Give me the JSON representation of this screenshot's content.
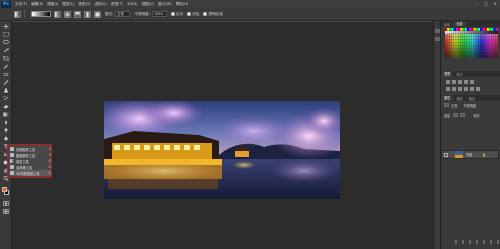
{
  "app": {
    "logo": "Ps"
  },
  "menu": [
    "文件(F)",
    "编辑(E)",
    "图像(I)",
    "图层(L)",
    "类型(Y)",
    "选择(S)",
    "滤镜(T)",
    "3D(D)",
    "视图(V)",
    "窗口(W)",
    "帮助(H)"
  ],
  "window_controls": {
    "minimize": "–",
    "maximize": "□",
    "close": "✕"
  },
  "options_bar": {
    "mode_label": "模式:",
    "mode_value": "正常",
    "opacity_label": "不透明度:",
    "opacity_value": "100%",
    "reverse_label": "反向",
    "dither_label": "仿色",
    "transparency_label": "透明区域"
  },
  "tool_flyout": {
    "items": [
      {
        "label": "仿制图章工具",
        "shortcut": "S"
      },
      {
        "label": "图案图章工具",
        "shortcut": "S"
      },
      {
        "label": "渐变工具",
        "shortcut": "G"
      },
      {
        "label": "油漆桶工具",
        "shortcut": "G"
      },
      {
        "label": "3D材质拖放工具",
        "shortcut": "G"
      }
    ]
  },
  "colors": {
    "foreground": "#ff5a00",
    "background": "#000000",
    "flyout_border": "#c41818"
  },
  "panels": {
    "top_tabs": [
      "颜色",
      "色板"
    ],
    "mid_tabs": [
      "调整",
      "样式"
    ],
    "layers_tabs": [
      "图层",
      "通道",
      "路径"
    ],
    "layer_controls": [
      "正常",
      "不透明度",
      "锁定",
      "填充"
    ],
    "layer_name": "背景"
  }
}
